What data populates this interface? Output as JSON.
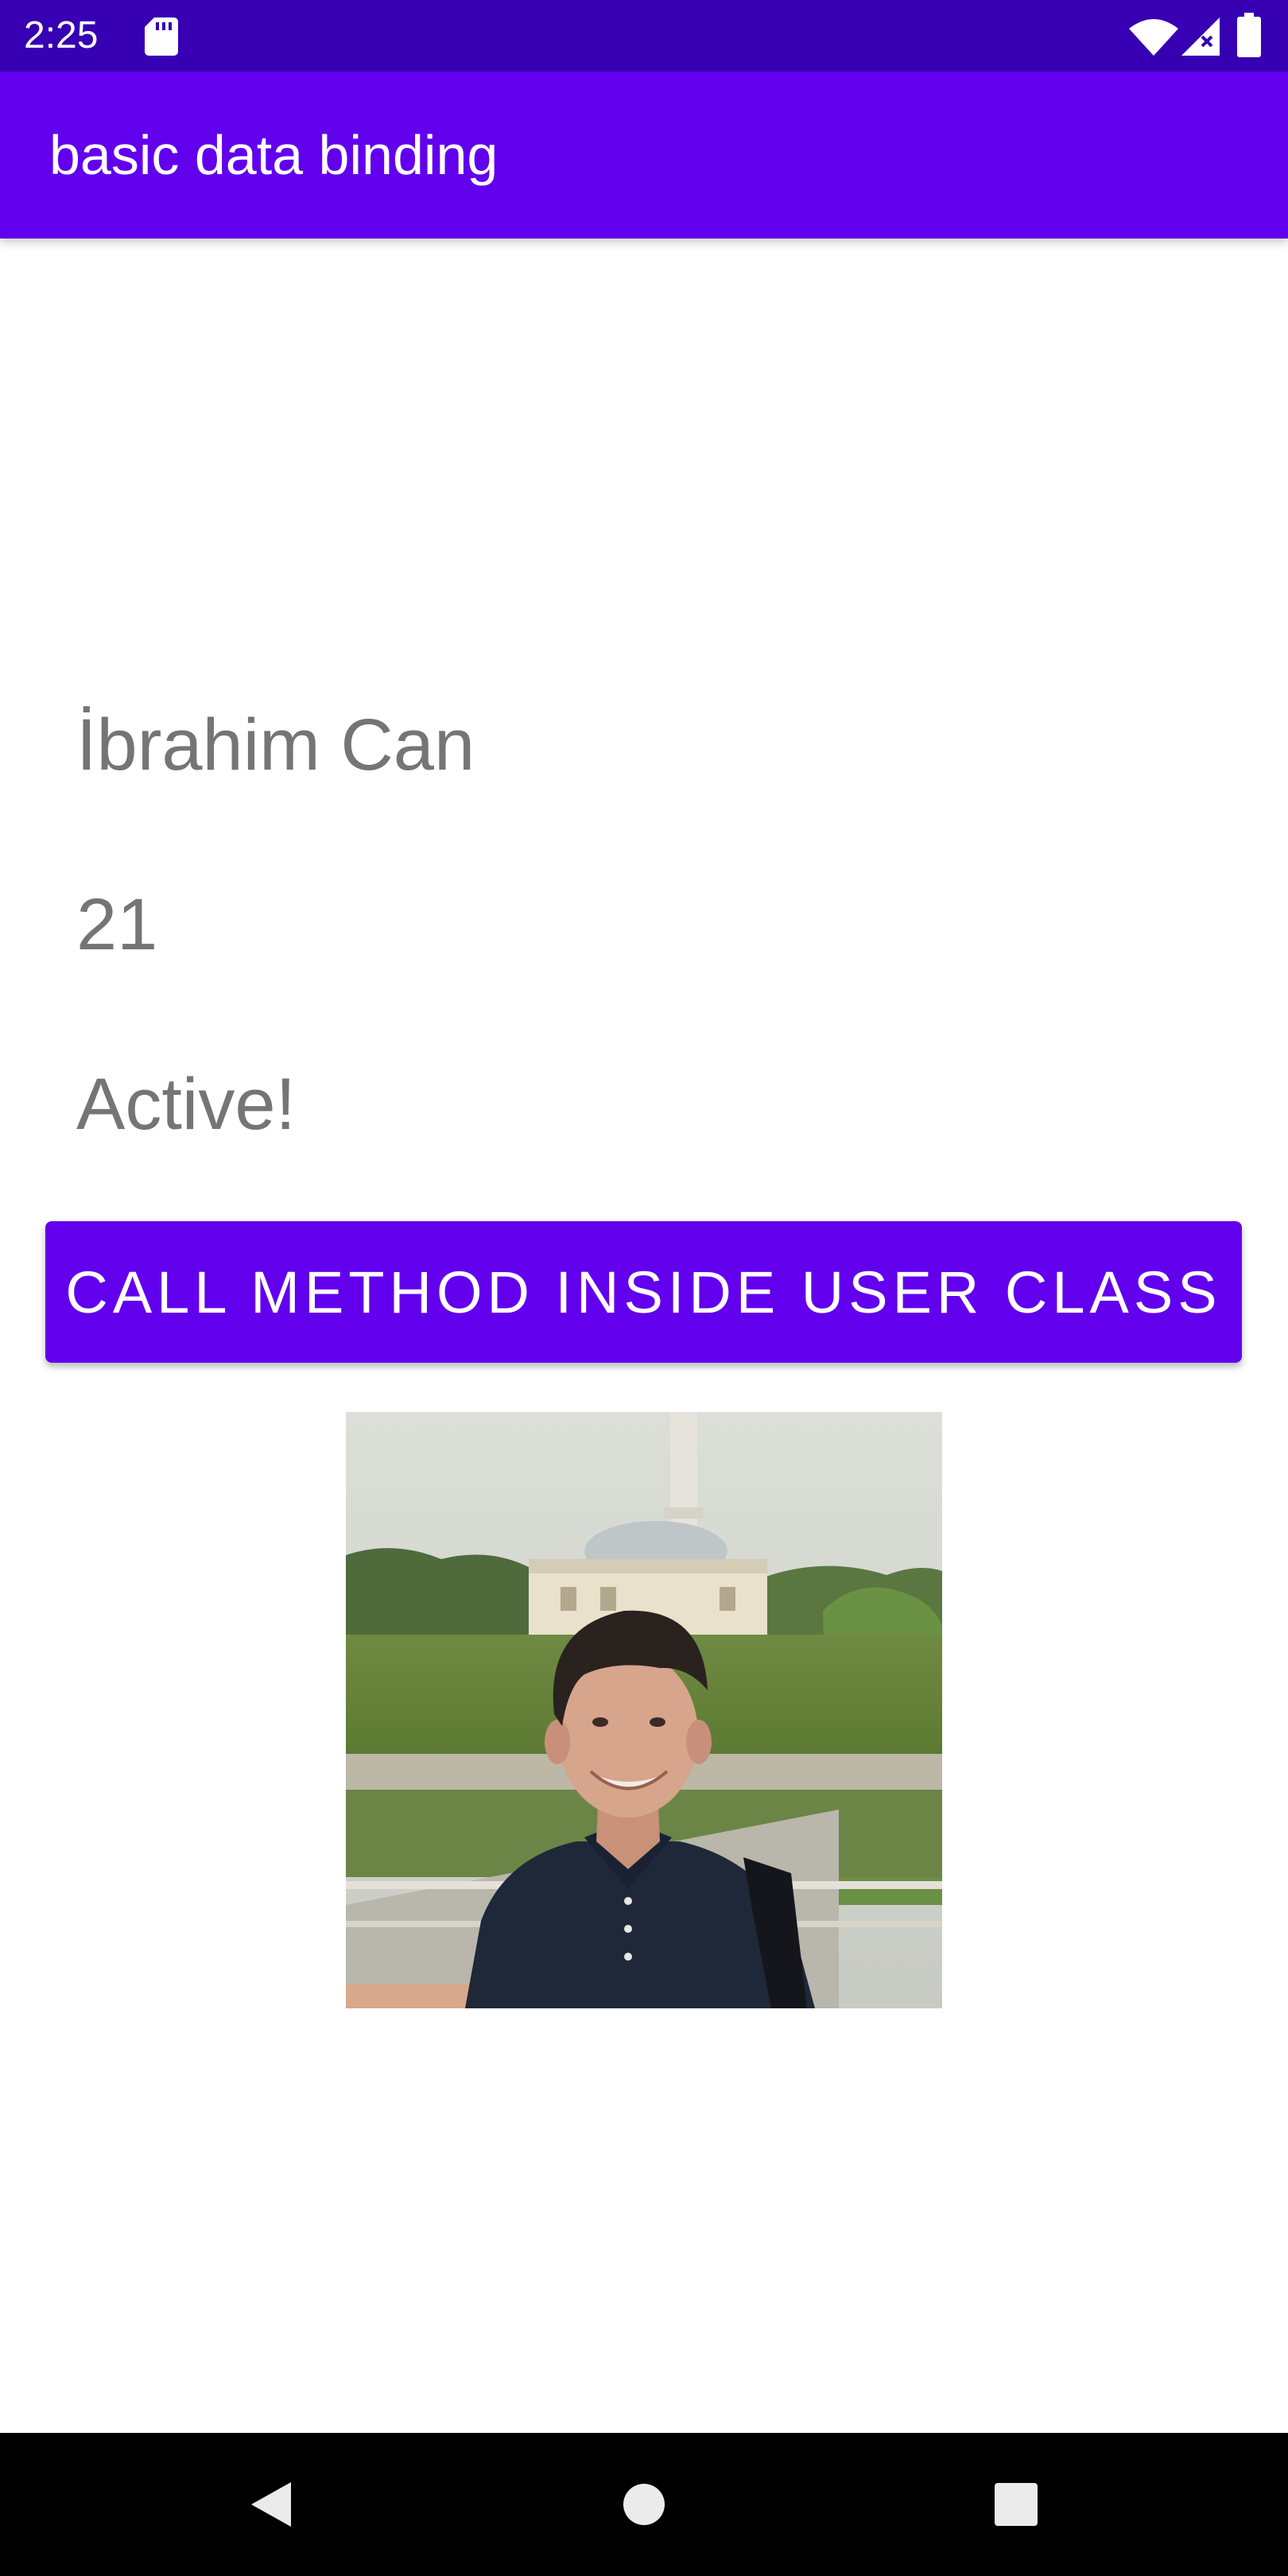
{
  "status_bar": {
    "time": "2:25",
    "icons": [
      "sd-card-icon",
      "wifi-icon",
      "signal-icon",
      "battery-icon"
    ]
  },
  "app_bar": {
    "title": "basic data binding"
  },
  "user": {
    "name": "İbrahim Can",
    "age": "21",
    "status": "Active!"
  },
  "actions": {
    "call_method_label": "CALL METHOD INSIDE USER CLASS"
  },
  "navigation": {
    "icons": [
      "back-icon",
      "home-icon",
      "recents-icon"
    ]
  },
  "colors": {
    "status_bar": "#3700b3",
    "primary": "#6200ee",
    "text_secondary": "#757575",
    "nav_bar": "#000000"
  }
}
